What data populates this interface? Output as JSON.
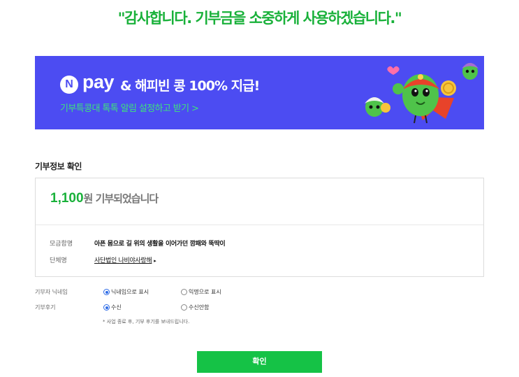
{
  "header": {
    "thanks": "\"감사합니다. 기부금을 소중하게 사용하겠습니다.\""
  },
  "banner": {
    "logo_letter": "N",
    "logo_word": "pay",
    "headline": "& 해피빈 콩 100% 지급!",
    "sub": "기부특콩대 톡톡 알림 설정하고 받기 >",
    "colors": {
      "background": "#4c4cf2",
      "sub_text": "#3ee27b"
    }
  },
  "donation": {
    "section_title": "기부정보 확인",
    "amount": "1,100",
    "amount_suffix": "원 기부되었습니다",
    "rows": [
      {
        "label": "모금함명",
        "value": "아픈 몸으로 길 위의 생활을 이어가던 깜패와 뚝딱이"
      },
      {
        "label": "단체명",
        "value": "사단법인 나비야사랑해",
        "arrow": "▸"
      }
    ]
  },
  "options": {
    "nickname": {
      "label": "기부자 닉네임",
      "choices": [
        "닉네임으로 표시",
        "익명으로 표시"
      ],
      "selected": "닉네임으로 표시"
    },
    "review": {
      "label": "기부후기",
      "choices": [
        "수신",
        "수신안함"
      ],
      "selected": "수신"
    },
    "note": "* 사업 종료 후, 기부 후기를 보내드립니다."
  },
  "actions": {
    "confirm": "확인"
  },
  "colors": {
    "accent": "#19b13a",
    "button": "#15c246",
    "radio": "#2d6be6"
  }
}
